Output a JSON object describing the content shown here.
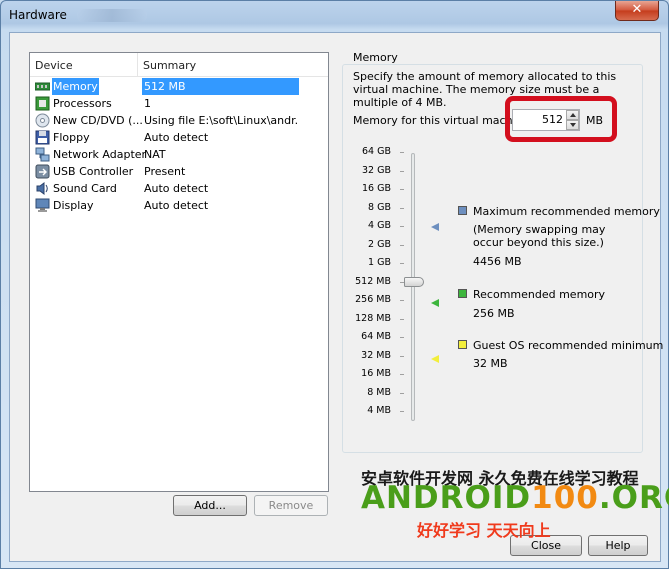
{
  "window": {
    "title": "Hardware",
    "close_glyph": "✕"
  },
  "device_list": {
    "headers": {
      "device": "Device",
      "summary": "Summary"
    },
    "rows": [
      {
        "icon": "memory-icon",
        "device": "Memory",
        "summary": "512 MB",
        "selected": true
      },
      {
        "icon": "processor-icon",
        "device": "Processors",
        "summary": "1"
      },
      {
        "icon": "cd-dvd-icon",
        "device": "New CD/DVD (...",
        "summary": "Using file E:\\soft\\Linux\\andr..."
      },
      {
        "icon": "floppy-icon",
        "device": "Floppy",
        "summary": "Auto detect"
      },
      {
        "icon": "network-adapter-icon",
        "device": "Network Adapter",
        "summary": "NAT"
      },
      {
        "icon": "usb-icon",
        "device": "USB Controller",
        "summary": "Present"
      },
      {
        "icon": "sound-icon",
        "device": "Sound Card",
        "summary": "Auto detect"
      },
      {
        "icon": "display-icon",
        "device": "Display",
        "summary": "Auto detect"
      }
    ],
    "add_label": "Add...",
    "remove_label": "Remove"
  },
  "memory": {
    "group_title": "Memory",
    "description": "Specify the amount of memory allocated to this virtual machine. The memory size must be a multiple of 4 MB.",
    "field_label": "Memory for this virtual machine:",
    "value": "512",
    "unit": "MB",
    "scale": [
      "64 GB",
      "32 GB",
      "16 GB",
      "8 GB",
      "4 GB",
      "2 GB",
      "1 GB",
      "512 MB",
      "256 MB",
      "128 MB",
      "64 MB",
      "32 MB",
      "16 MB",
      "8 MB",
      "4 MB"
    ],
    "current_level": "512 MB",
    "legend": {
      "max_title": "Maximum recommended memory",
      "max_note": "(Memory swapping may occur beyond this size.)",
      "max_value": "4456 MB",
      "rec_title": "Recommended memory",
      "rec_value": "256 MB",
      "min_title": "Guest OS recommended minimum",
      "min_value": "32 MB"
    },
    "colors": {
      "max": "#6d8fbf",
      "recommended": "#3db53d",
      "minimum": "#f2ee3c",
      "highlight": "#d30f1e"
    }
  },
  "footer": {
    "close_label": "Close",
    "help_label": "Help"
  },
  "watermark": {
    "line1": "安卓软件开发网 永久免费在线学习教程",
    "brand_a": "ANDROID",
    "brand_b": "100",
    "brand_c": ".ORG",
    "line3": "好好学习 天天向上"
  }
}
